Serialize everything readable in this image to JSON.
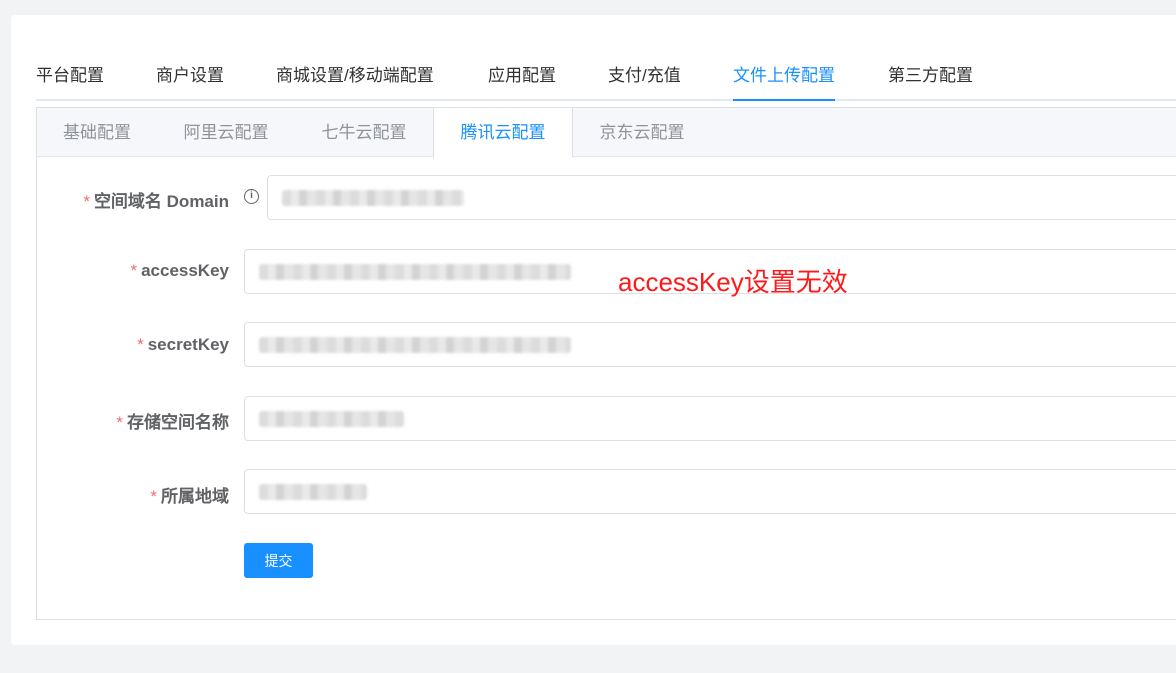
{
  "top_tabs": {
    "items": [
      {
        "label": "平台配置"
      },
      {
        "label": "商户设置"
      },
      {
        "label": "商城设置/移动端配置"
      },
      {
        "label": "应用配置"
      },
      {
        "label": "支付/充值"
      },
      {
        "label": "文件上传配置"
      },
      {
        "label": "第三方配置"
      }
    ],
    "active": "文件上传配置"
  },
  "sub_tabs": {
    "items": [
      {
        "label": "基础配置"
      },
      {
        "label": "阿里云配置"
      },
      {
        "label": "七牛云配置"
      },
      {
        "label": "腾讯云配置"
      },
      {
        "label": "京东云配置"
      }
    ],
    "active": "腾讯云配置"
  },
  "form": {
    "required_mark": "*",
    "info_icon": "i",
    "fields": [
      {
        "label": "空间域名 Domain",
        "value": "",
        "masked": true
      },
      {
        "label": "accessKey",
        "value": "",
        "masked": true
      },
      {
        "label": "secretKey",
        "value": "",
        "masked": true
      },
      {
        "label": "存储空间名称",
        "value": "",
        "masked": true
      },
      {
        "label": "所属地域",
        "value": "",
        "masked": true
      }
    ],
    "submit_label": "提交"
  },
  "annotation": {
    "text": "accessKey设置无效",
    "color": "#ff1a1a"
  },
  "colors": {
    "accent": "#1890ff",
    "required": "#f56c6c"
  }
}
